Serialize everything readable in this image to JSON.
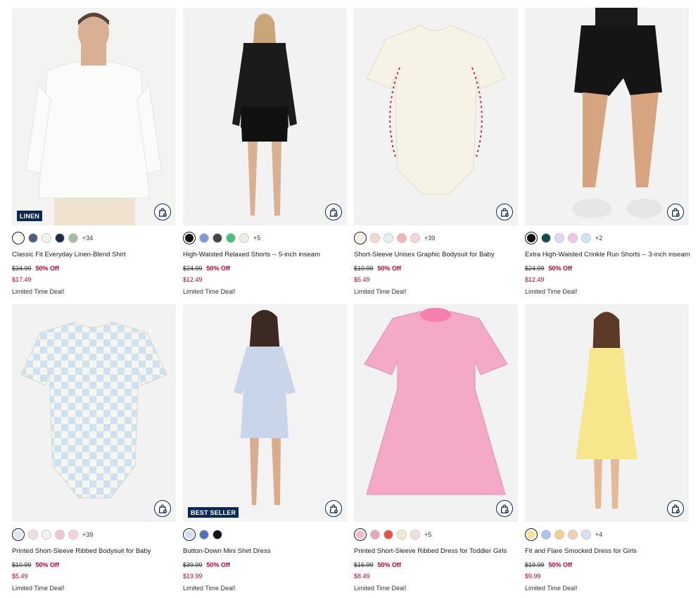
{
  "products": [
    {
      "name": "Classic Fit Everyday Linen-Blend Shirt",
      "badge": "LINEN",
      "swatches": [
        "#ffffff",
        "#4d6178",
        "#f2f2f2",
        "#1c2a4a",
        "#a9b8a8"
      ],
      "selected_swatch": 0,
      "more": "+34",
      "orig_price": "$34.99",
      "discount": "50% Off",
      "sale_price": "$17.49",
      "deal": "Limited Time Deal!",
      "image": "man-white-linen-shirt"
    },
    {
      "name": "High-Waisted Relaxed Shorts -- 5-inch inseam",
      "badge": "",
      "swatches": [
        "#111111",
        "#7f9ad4",
        "#444444",
        "#4dbf7a",
        "#efefe9"
      ],
      "selected_swatch": 0,
      "more": "+5",
      "orig_price": "$24.99",
      "discount": "50% Off",
      "sale_price": "$12.49",
      "deal": "Limited Time Deal!",
      "image": "woman-black-outfit"
    },
    {
      "name": "Short-Sleeve Unisex Graphic Bodysuit for Baby",
      "badge": "",
      "swatches": [
        "#f5efe2",
        "#f7d7d0",
        "#e8f0f6",
        "#f2b4b4",
        "#f8d3dc"
      ],
      "selected_swatch": 0,
      "more": "+39",
      "orig_price": "$10.99",
      "discount": "50% Off",
      "sale_price": "$5.49",
      "deal": "Limited Time Deal!",
      "image": "baseball-bodysuit"
    },
    {
      "name": "Extra High-Waisted Crinkle Run Shorts -- 3-inch inseam",
      "badge": "",
      "swatches": [
        "#111111",
        "#0f4c4e",
        "#e5d6f2",
        "#f0c6e9",
        "#cfe3f7"
      ],
      "selected_swatch": 0,
      "more": "+2",
      "orig_price": "$24.99",
      "discount": "50% Off",
      "sale_price": "$12.49",
      "deal": "Limited Time Deal!",
      "image": "woman-run-shorts"
    },
    {
      "name": "Printed Short-Sleeve Ribbed Bodysuit for Baby",
      "badge": "",
      "swatches": [
        "#dbe9f5",
        "#f7e0dc",
        "#f3f3f3",
        "#f3c6cf",
        "#f9d2dc"
      ],
      "selected_swatch": 0,
      "more": "+39",
      "orig_price": "$10.99",
      "discount": "50% Off",
      "sale_price": "$5.49",
      "deal": "Limited Time Deal!",
      "image": "star-check-bodysuit"
    },
    {
      "name": "Button-Down Mini Shirt Dress",
      "badge": "BEST SELLER",
      "swatches": [
        "#cfe0f3",
        "#4d70b9",
        "#111111"
      ],
      "selected_swatch": 0,
      "more": "",
      "orig_price": "$39.99",
      "discount": "50% Off",
      "sale_price": "$19.99",
      "deal": "Limited Time Deal!",
      "image": "woman-shirt-dress"
    },
    {
      "name": "Printed Short-Sleeve Ribbed Dress for Toddler Girls",
      "badge": "",
      "swatches": [
        "#f6b9d0",
        "#e8a7b8",
        "#e3514f",
        "#f4ead2",
        "#f5e1dc"
      ],
      "selected_swatch": 0,
      "more": "+5",
      "orig_price": "$16.99",
      "discount": "50% Off",
      "sale_price": "$8.49",
      "deal": "Limited Time Deal!",
      "image": "pink-floral-dress"
    },
    {
      "name": "Fit and Flare Smocked Dress for Girls",
      "badge": "",
      "swatches": [
        "#f7e49a",
        "#a9c2ee",
        "#f4d28b",
        "#f5cdb4",
        "#d6e2ee"
      ],
      "selected_swatch": 0,
      "more": "+4",
      "orig_price": "$19.99",
      "discount": "50% Off",
      "sale_price": "$9.99",
      "deal": "Limited Time Deal!",
      "image": "girl-yellow-dress"
    }
  ],
  "colors": {
    "brand_navy": "#0b2853",
    "sale_red": "#c6002a"
  },
  "icons": {
    "quick_add": "bag-plus-icon"
  }
}
